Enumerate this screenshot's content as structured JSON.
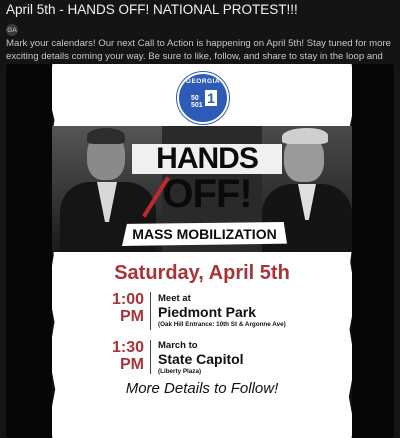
{
  "post": {
    "title": "April 5th - HANDS OFF! NATIONAL PROTEST!!!",
    "author_initials": "GA",
    "description": "Mark your calendars! Our next Call to Action is happening on April 5th! Stay tuned for more exciting details coming your way. Be sure to like, follow, and share to stay in the loop and never miss an update!"
  },
  "poster": {
    "seal_name": "GEORGIA",
    "seal_number": "50",
    "seal_number2": "501",
    "headline_1": "HANDS",
    "headline_2": "OFF!",
    "subheadline": "MASS MOBILIZATION",
    "date": "Saturday, April 5th",
    "event1": {
      "time_1": "1:00",
      "time_2": "PM",
      "lead": "Meet at",
      "place": "Piedmont Park",
      "detail": "(Oak Hill Entrance: 10th St & Argonne Ave)"
    },
    "event2": {
      "time_1": "1:30",
      "time_2": "PM",
      "lead": "March to",
      "place": "State Capitol",
      "detail": "(Liberty Plaza)"
    },
    "footer": "More Details to Follow!"
  },
  "colors": {
    "accent_red": "#a8343a",
    "seal_blue": "#2f5bb8",
    "background": "#141414"
  }
}
